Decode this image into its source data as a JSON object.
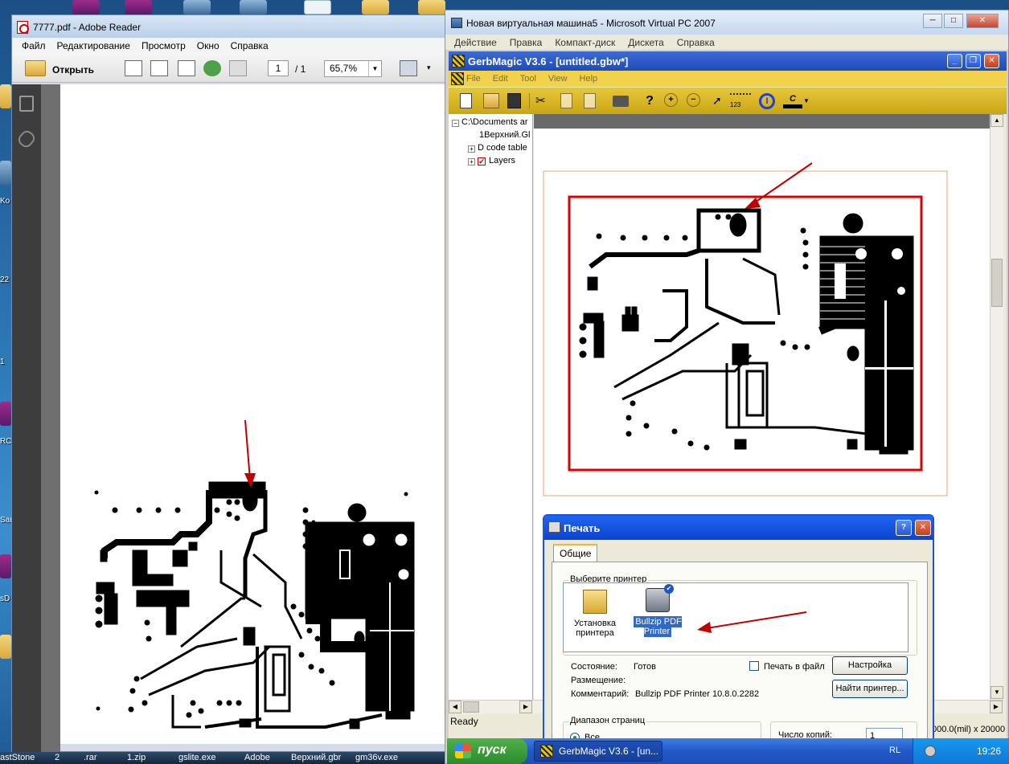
{
  "desktop": {
    "side_labels": [
      "Ko",
      "22",
      "1",
      "RC",
      "Sar",
      "sD"
    ],
    "taskbar_labels": [
      "astStone",
      "2",
      ".rar",
      "1.zip",
      "gslite.exe",
      "Adobe",
      "Верхний.gbr",
      "gm36v.exe"
    ]
  },
  "adobe": {
    "title": "7777.pdf - Adobe Reader",
    "menu": [
      "Файл",
      "Редактирование",
      "Просмотр",
      "Окно",
      "Справка"
    ],
    "open_label": "Открыть",
    "page_current": "1",
    "page_total": "/ 1",
    "zoom": "65,7%"
  },
  "vpc": {
    "title": "Новая виртуальная машина5 - Microsoft Virtual PC 2007",
    "menu": [
      "Действие",
      "Правка",
      "Компакт-диск",
      "Дискета",
      "Справка"
    ]
  },
  "gerbmagic": {
    "title": "GerbMagic V3.6 - [untitled.gbw*]",
    "menu": [
      "File",
      "Edit",
      "Tool",
      "View",
      "Help"
    ],
    "tree": {
      "root": "C:\\Documents ar",
      "file": "1Верхний.Gl",
      "dcode": "D code table",
      "layers": "Layers"
    },
    "status_left": "Ready",
    "status_right": "000.0(mil) x 20000"
  },
  "print_dialog": {
    "title": "Печать",
    "tab": "Общие",
    "select_printer": "Выберите принтер",
    "printers": [
      {
        "name": "Установка принтера",
        "icon": "add-printer-icon"
      },
      {
        "name": "Bullzip PDF Printer",
        "icon": "printer-icon"
      }
    ],
    "status_label": "Состояние:",
    "status_value": "Готов",
    "location_label": "Размещение:",
    "comment_label": "Комментарий:",
    "comment_value": "Bullzip PDF Printer 10.8.0.2282",
    "print_to_file": "Печать в файл",
    "settings_btn": "Настройка",
    "find_printer_btn": "Найти принтер...",
    "page_range": "Диапазон страниц",
    "range_all": "Все",
    "copies_label": "Число копий:",
    "copies_value": "1"
  },
  "xp_taskbar": {
    "start": "пуск",
    "task": "GerbMagic V3.6 - [un...",
    "lang": "RL",
    "clock": "19:26"
  },
  "colors": {
    "arrow": "#c00000",
    "xp_blue": "#1f5fd6",
    "gm_yellow": "#e0c030"
  }
}
